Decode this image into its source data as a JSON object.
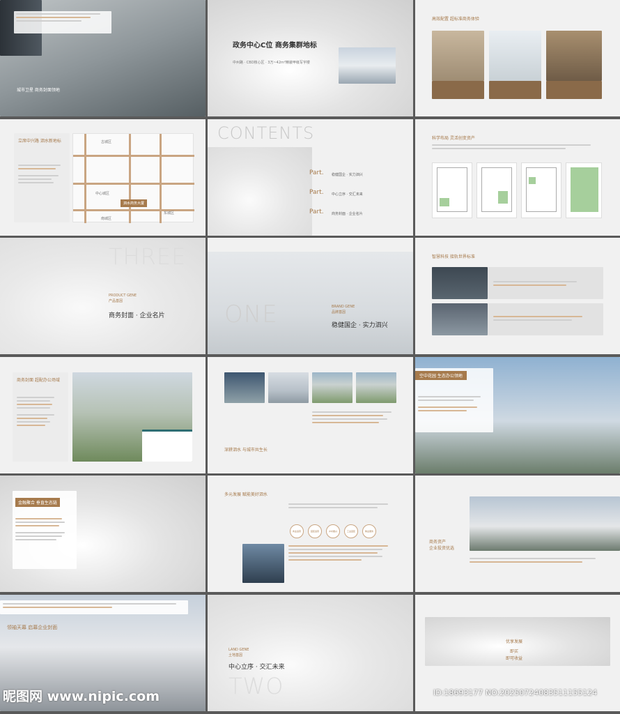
{
  "slides": {
    "s1": {
      "caption": "城市卫星 商务封面领地"
    },
    "s2": {
      "title": "政务中心C位 商务集群地标",
      "sub": "中州路 · CBD核心区 · 3万~42m²精装甲级写字楼"
    },
    "s3": {
      "title": "高效配置 超标准商务体验"
    },
    "s4": {
      "title": "立席中兴路 泗水新地标",
      "map_labels": [
        "古城区",
        "中心城区",
        "东城区",
        "南城区",
        "泗水商务大厦"
      ]
    },
    "s5": {
      "title": "CONTENTS",
      "parts": [
        {
          "label": "Part.",
          "text": "稳健国企 · 实力泗兴"
        },
        {
          "label": "Part.",
          "text": "中心立序 · 交汇未来"
        },
        {
          "label": "Part.",
          "text": "商务封面 · 企业名片"
        }
      ]
    },
    "s6": {
      "title": "科学布局 灵活创变资产"
    },
    "s7": {
      "ghost": "THREE",
      "label_en": "PRODUCT GENE",
      "label_cn": "产品基因",
      "title": "商务封面 · 企业名片"
    },
    "s8": {
      "ghost": "ONE",
      "label_en": "BRAND GENE",
      "label_cn": "品牌基因",
      "title": "稳健国企 · 实力泗兴"
    },
    "s9": {
      "title": "智慧科技 接轨世界标准"
    },
    "s10": {
      "title": "商务封面 超配办公场域"
    },
    "s11": {
      "title": "深耕泗水 与城市共生长"
    },
    "s12": {
      "title": "空中花园 生态办公领地"
    },
    "s13": {
      "title": "金融聚合 垂直生态链"
    },
    "s14": {
      "title": "多元发展 赋能美好泗水",
      "circles": [
        "商业运营",
        "园区运营",
        "乡村振兴",
        "工业园区",
        "物业服务"
      ]
    },
    "s15": {
      "title1": "商务资产",
      "title2": "企业投资优选"
    },
    "s16": {
      "title": "领袖天幕 启幕企业封面"
    },
    "s17": {
      "ghost": "TWO",
      "label_en": "LAND GENE",
      "label_cn": "土地基因",
      "title": "中心立序 · 交汇未来"
    },
    "s18": {
      "line1": "优享发展",
      "line2": "即买",
      "line3": "即可收益"
    }
  },
  "watermark": "昵图网 www.nipic.com",
  "image_id": "ID:18693177 NO:20250724083511155124"
}
